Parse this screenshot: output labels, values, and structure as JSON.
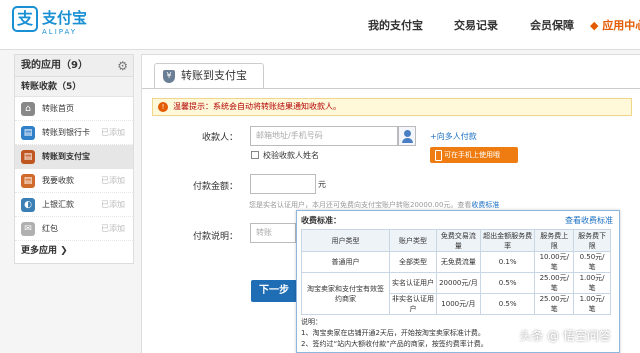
{
  "brand": {
    "logo_cn": "支付宝",
    "logo_en": "ALIPAY",
    "mark": "支"
  },
  "nav": {
    "my_alipay": "我的支付宝",
    "records": "交易记录",
    "protection": "会员保障",
    "apps": "◆ 应用中心"
  },
  "left": {
    "header": "我的应用（9）",
    "section": "转账收款（5）",
    "more": "更多应用 ❯",
    "items": [
      {
        "label": "转账首页",
        "added": "",
        "color": "#888",
        "glyph": "⌂"
      },
      {
        "label": "转账到银行卡",
        "added": "已添加",
        "color": "#2f7fc9",
        "glyph": "▤"
      },
      {
        "label": "转账到支付宝",
        "added": "",
        "color": "#c0561f",
        "glyph": "▤"
      },
      {
        "label": "我要收款",
        "added": "已添加",
        "color": "#d06a2a",
        "glyph": "▤"
      },
      {
        "label": "上银汇款",
        "added": "已添加",
        "color": "#3c7fb5",
        "glyph": "◐"
      },
      {
        "label": "红包",
        "added": "已添加",
        "color": "#b0b0b0",
        "glyph": "✉"
      }
    ]
  },
  "tab": {
    "label": "转账到支付宝"
  },
  "notice": {
    "text": "温馨提示：系统会自动将转账结果通知收款人。"
  },
  "form": {
    "payee_label": "收款人：",
    "payee_placeholder": "邮箱地址/手机号码",
    "multi_link": "+向多人付款",
    "verify_name": "校验收款人姓名",
    "mobile_btn": "可在手机上使用哦",
    "amount_label": "付款金额：",
    "amount_unit": "元",
    "hint": "您是实名认证用户，本月还可免费向支付宝账户转账20000.00元。查看",
    "hint_link": "收费标准",
    "memo_label": "付款说明：",
    "memo_placeholder": "转账",
    "next": "下一步"
  },
  "fee_popup": {
    "title": "收费标准：",
    "link": "查看收费标准",
    "headers": [
      "用户类型",
      "账户类型",
      "免费交易流量",
      "超出金额服务费率",
      "服务费上限",
      "服务费下限"
    ],
    "rows": [
      [
        "普通用户",
        "全部类型",
        "无免费流量",
        "0.1%",
        "10.00元/笔",
        "0.50元/笔"
      ],
      [
        "淘宝卖家和支付宝有效签约商家",
        "实名认证用户",
        "20000元/月",
        "0.5%",
        "25.00元/笔",
        "1.00元/笔"
      ],
      [
        "",
        "非实名认证用户",
        "1000元/月",
        "0.5%",
        "25.00元/笔",
        "1.00元/笔"
      ]
    ],
    "note_title": "说明：",
    "note1": "1、淘宝卖家在店铺开通2天后，开始按淘宝卖家标准计费。",
    "note2": "2、签约过“站内大额收付款”产品的商家，按签约费率计费。"
  },
  "watermark": "头条 @ 悟空问答"
}
